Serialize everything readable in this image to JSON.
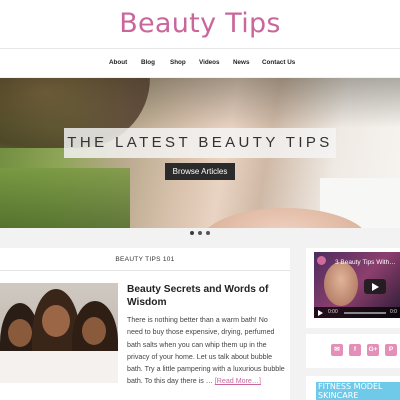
{
  "site": {
    "title": "Beauty Tips"
  },
  "nav": {
    "items": [
      {
        "label": "About"
      },
      {
        "label": "Blog"
      },
      {
        "label": "Shop"
      },
      {
        "label": "Videos"
      },
      {
        "label": "News"
      },
      {
        "label": "Contact Us"
      }
    ]
  },
  "hero": {
    "banner_text": "THE LATEST BEAUTY TIPS",
    "button_label": "Browse Articles"
  },
  "main": {
    "section_label": "BEAUTY TIPS 101",
    "article": {
      "title": "Beauty Secrets and Words of Wisdom",
      "excerpt": "There is nothing better than a warm bath! No need to buy those expensive, drying, perfumed bath salts when you can whip them up in the privacy of your home. Let us talk about bubble bath. Try a little pampering with a luxurious bubble bath. To this day there is …",
      "read_more": "[Read More…]"
    }
  },
  "sidebar": {
    "video": {
      "title": "3 Beauty Tips With…",
      "time_current": "0:00",
      "time_end": "0:0"
    },
    "social": [
      {
        "icon": "email-icon",
        "glyph": "✉"
      },
      {
        "icon": "facebook-icon",
        "glyph": "f"
      },
      {
        "icon": "google-plus-icon",
        "glyph": "G+"
      },
      {
        "icon": "pinterest-icon",
        "glyph": "P"
      }
    ],
    "ad": {
      "text": "FITNESS MODEL SKINCARE"
    }
  },
  "colors": {
    "brand": "#c9679c",
    "social": "#e48fb7",
    "ad": "#6fc9e9"
  }
}
